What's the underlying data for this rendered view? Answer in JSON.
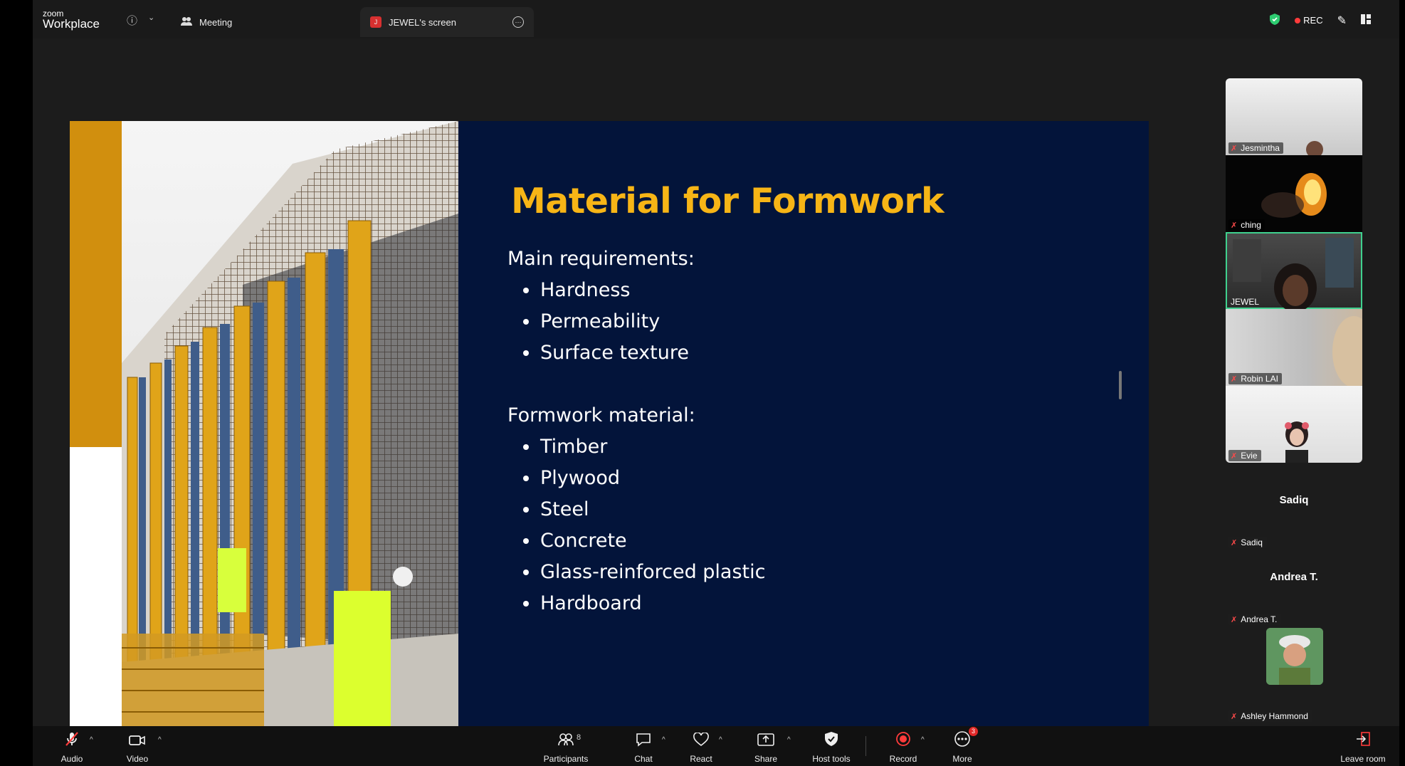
{
  "app": {
    "brand_small": "zoom",
    "brand_big": "Workplace"
  },
  "tabs": [
    {
      "label": "Meeting"
    },
    {
      "label": "JEWEL's screen",
      "badge": "J"
    }
  ],
  "status": {
    "rec_label": "REC"
  },
  "slide": {
    "title": "Material for Formwork",
    "section1_heading": "Main requirements:",
    "section1_items": [
      "Hardness",
      "Permeability",
      "Surface texture"
    ],
    "section2_heading": "Formwork material:",
    "section2_items": [
      "Timber",
      "Plywood",
      "Steel",
      "Concrete",
      "Glass-reinforced plastic",
      "Hardboard"
    ]
  },
  "participants": {
    "video_tiles": [
      {
        "name": "Jesmintha"
      },
      {
        "name": "ching"
      },
      {
        "name": "JEWEL",
        "active": true
      },
      {
        "name": "Robin LAI"
      },
      {
        "name": "Evie"
      }
    ],
    "name_tiles": [
      {
        "display": "Sadiq",
        "label": "Sadiq"
      },
      {
        "display": "Andrea T.",
        "label": "Andrea T."
      }
    ],
    "avatar_tile": {
      "label": "Ashley Hammond"
    }
  },
  "toolbar": {
    "audio": "Audio",
    "video": "Video",
    "participants": "Participants",
    "participants_count": "8",
    "chat": "Chat",
    "react": "React",
    "share": "Share",
    "host_tools": "Host tools",
    "record": "Record",
    "more": "More",
    "more_badge": "3",
    "leave": "Leave room"
  },
  "colors": {
    "slide_bg": "#03143a",
    "title": "#f7b516",
    "accent_gold": "#d18f0e",
    "active_border": "#3fd18e",
    "record_red": "#ff3b3b"
  }
}
